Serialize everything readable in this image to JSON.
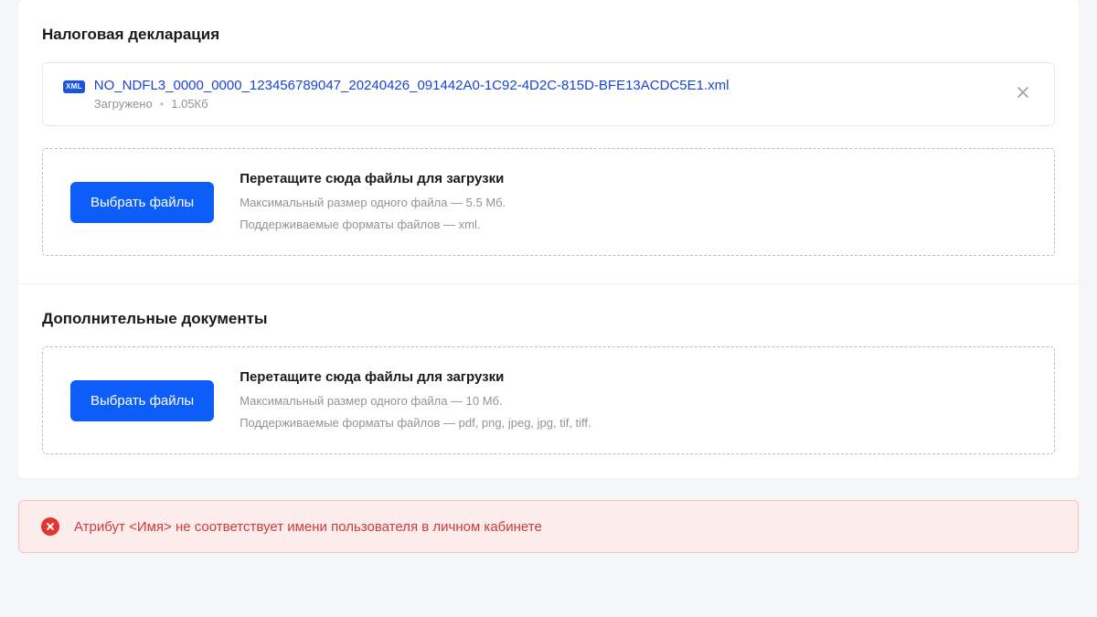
{
  "declaration": {
    "title": "Налоговая декларация",
    "file": {
      "icon_label": "XML",
      "name": "NO_NDFL3_0000_0000_123456789047_20240426_091442A0-1C92-4D2C-815D-BFE13ACDC5E1.xml",
      "status": "Загружено",
      "size": "1.05Кб"
    },
    "dropzone": {
      "button": "Выбрать файлы",
      "title": "Перетащите сюда файлы для загрузки",
      "line1": "Максимальный размер одного файла — 5.5 Мб.",
      "line2": "Поддерживаемые форматы файлов — xml."
    }
  },
  "additional": {
    "title": "Дополнительные документы",
    "dropzone": {
      "button": "Выбрать файлы",
      "title": "Перетащите сюда файлы для загрузки",
      "line1": "Максимальный размер одного файла — 10 Мб.",
      "line2": "Поддерживаемые форматы файлов — pdf, png, jpeg, jpg, tif, tiff."
    }
  },
  "error": {
    "message": "Атрибут <Имя> не соответствует имени пользователя в личном кабинете"
  }
}
